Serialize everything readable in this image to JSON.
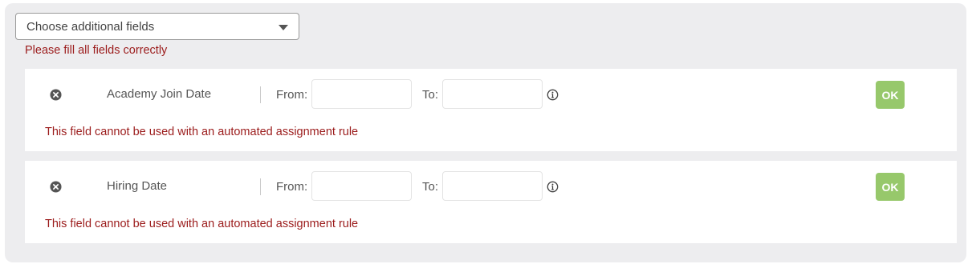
{
  "fields_selector": {
    "placeholder": "Choose additional fields",
    "icon": "caret-down-icon"
  },
  "validation": {
    "message": "Please fill all fields correctly"
  },
  "colors": {
    "panel_background": "#ededef",
    "error_text": "#9b1b1b",
    "ok_button": "#97c86b"
  },
  "field_rows": [
    {
      "label": "Academy Join Date",
      "from_label": "From:",
      "from_value": "",
      "to_label": "To:",
      "to_value": "",
      "ok_label": "OK",
      "error": "This field cannot be used with an automated assignment rule",
      "remove_icon": "close-circle-icon",
      "info_icon": "info-icon"
    },
    {
      "label": "Hiring Date",
      "from_label": "From:",
      "from_value": "",
      "to_label": "To:",
      "to_value": "",
      "ok_label": "OK",
      "error": "This field cannot be used with an automated assignment rule",
      "remove_icon": "close-circle-icon",
      "info_icon": "info-icon"
    }
  ]
}
